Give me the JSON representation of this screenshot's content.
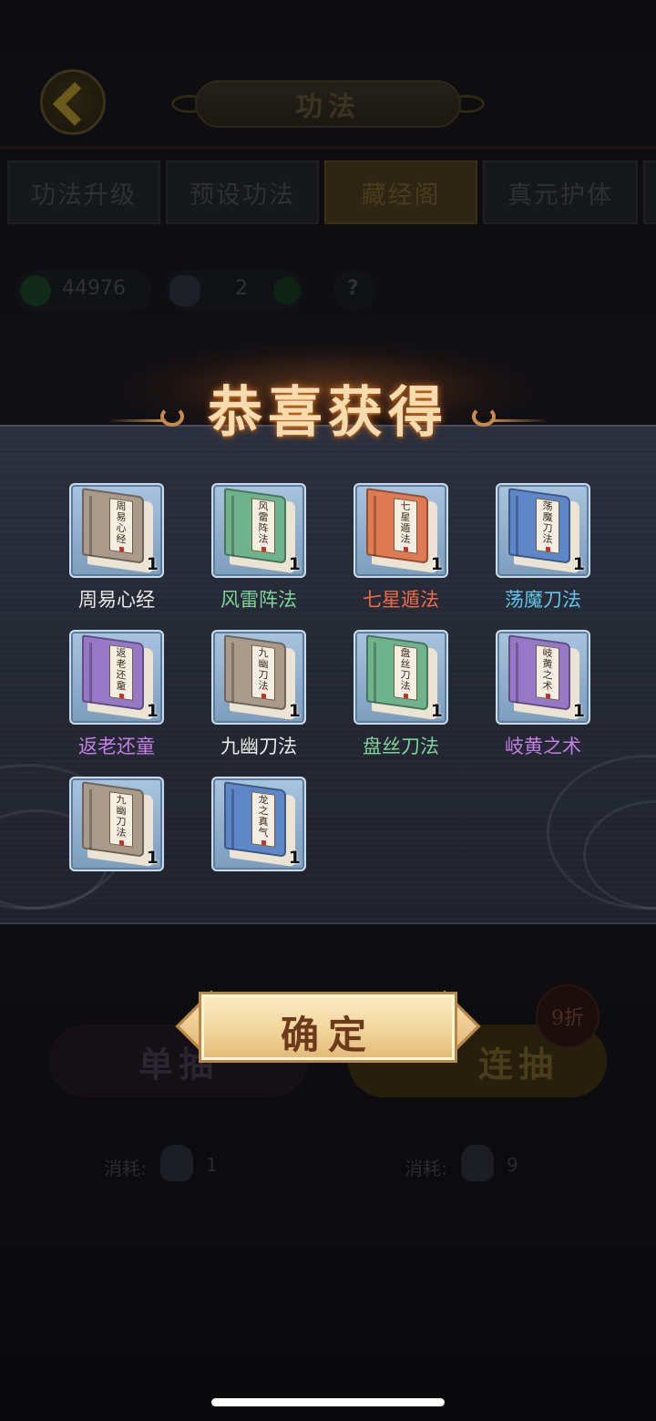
{
  "header": {
    "title": "功法"
  },
  "tabs": [
    {
      "label": "功法升级",
      "active": false
    },
    {
      "label": "预设功法",
      "active": false
    },
    {
      "label": "藏经阁",
      "active": true
    },
    {
      "label": "真元护体",
      "active": false
    }
  ],
  "currencies": {
    "coins": "44976",
    "tokens": "2",
    "help": "?"
  },
  "reward": {
    "title": "恭喜获得",
    "items": [
      {
        "name": "周易心经",
        "book_text": "周易心经",
        "qty": "1",
        "cover_color": "#a99a8a",
        "name_color": "#e8e8e8"
      },
      {
        "name": "风雷阵法",
        "book_text": "风雷阵法",
        "qty": "1",
        "cover_color": "#6fb38c",
        "name_color": "#7fd39a"
      },
      {
        "name": "七星遁法",
        "book_text": "七星遁法",
        "qty": "1",
        "cover_color": "#df7a52",
        "name_color": "#ef6b47"
      },
      {
        "name": "荡魔刀法",
        "book_text": "荡魔刀法",
        "qty": "1",
        "cover_color": "#5e87c9",
        "name_color": "#5fc6e8"
      },
      {
        "name": "返老还童",
        "book_text": "返老还童",
        "qty": "1",
        "cover_color": "#9778c6",
        "name_color": "#c27fe8"
      },
      {
        "name": "九幽刀法",
        "book_text": "九幽刀法",
        "qty": "1",
        "cover_color": "#a99a8a",
        "name_color": "#e8e8e8"
      },
      {
        "name": "盘丝刀法",
        "book_text": "盘丝刀法",
        "qty": "1",
        "cover_color": "#6fb38c",
        "name_color": "#7fd39a"
      },
      {
        "name": "岐黄之术",
        "book_text": "岐黄之术",
        "qty": "1",
        "cover_color": "#9778c6",
        "name_color": "#c27fe8"
      },
      {
        "name": "",
        "book_text": "九幽刀法",
        "qty": "1",
        "cover_color": "#a99a8a",
        "name_color": "#e8e8e8"
      },
      {
        "name": "",
        "book_text": "龙之真气",
        "qty": "1",
        "cover_color": "#5e87c9",
        "name_color": "#5fc6e8"
      }
    ],
    "confirm_label": "确定"
  },
  "draw": {
    "single_label": "单抽",
    "multi_label": "连抽",
    "discount": "9折",
    "cost_label": "消耗:",
    "single_cost": "1",
    "multi_cost": "9"
  }
}
